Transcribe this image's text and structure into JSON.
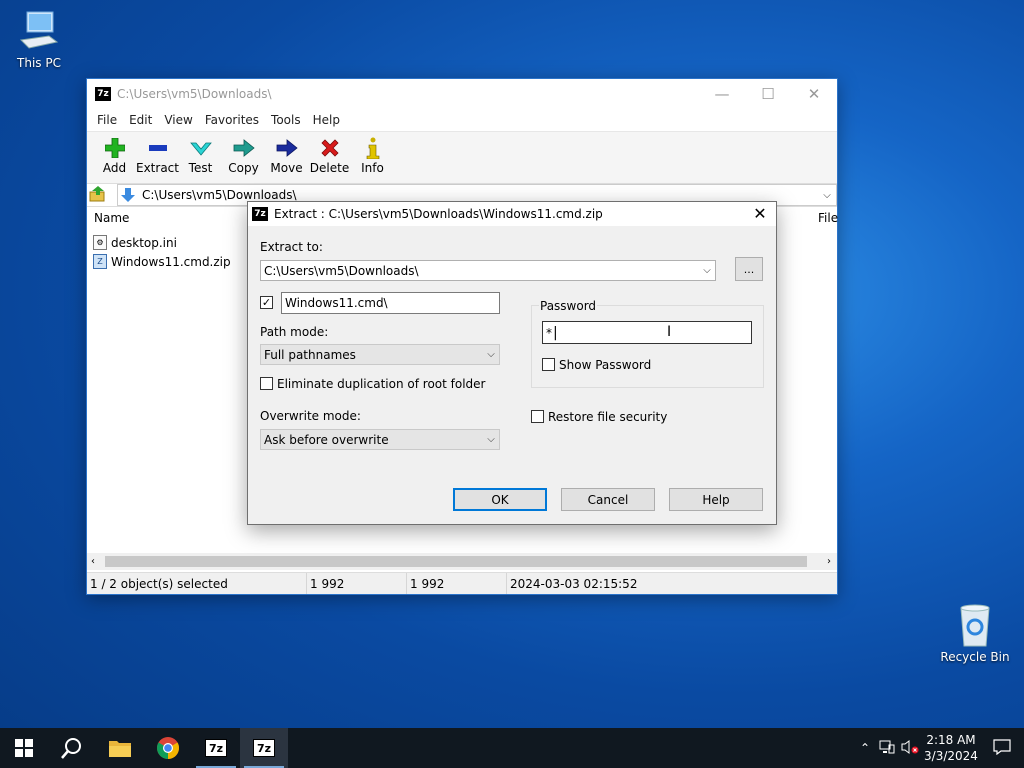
{
  "desktop": {
    "this_pc": "This PC",
    "recycle_bin": "Recycle Bin"
  },
  "main": {
    "title": "C:\\Users\\vm5\\Downloads\\",
    "app_icon": "7z",
    "menu": [
      "File",
      "Edit",
      "View",
      "Favorites",
      "Tools",
      "Help"
    ],
    "toolbar": {
      "add": "Add",
      "extract": "Extract",
      "test": "Test",
      "copy": "Copy",
      "move": "Move",
      "delete": "Delete",
      "info": "Info"
    },
    "address": "C:\\Users\\vm5\\Downloads\\",
    "columns": {
      "name": "Name",
      "file": "File"
    },
    "files": [
      "desktop.ini",
      "Windows11.cmd.zip"
    ],
    "status": {
      "selected": "1 / 2 object(s) selected",
      "size1": "1 992",
      "size2": "1 992",
      "date": "2024-03-03 02:15:52"
    }
  },
  "dialog": {
    "title": "Extract : C:\\Users\\vm5\\Downloads\\Windows11.cmd.zip",
    "extract_to_label": "Extract to:",
    "extract_to_value": "C:\\Users\\vm5\\Downloads\\",
    "browse": "...",
    "subfolder_value": "Windows11.cmd\\",
    "path_mode_label": "Path mode:",
    "path_mode_value": "Full pathnames",
    "eliminate_dup": "Eliminate duplication of root folder",
    "overwrite_label": "Overwrite mode:",
    "overwrite_value": "Ask before overwrite",
    "password_label": "Password",
    "password_value": "*",
    "show_password": "Show Password",
    "restore_security": "Restore file security",
    "ok": "OK",
    "cancel": "Cancel",
    "help": "Help"
  },
  "taskbar": {
    "time": "2:18 AM",
    "date": "3/3/2024",
    "sz_label": "7z"
  }
}
